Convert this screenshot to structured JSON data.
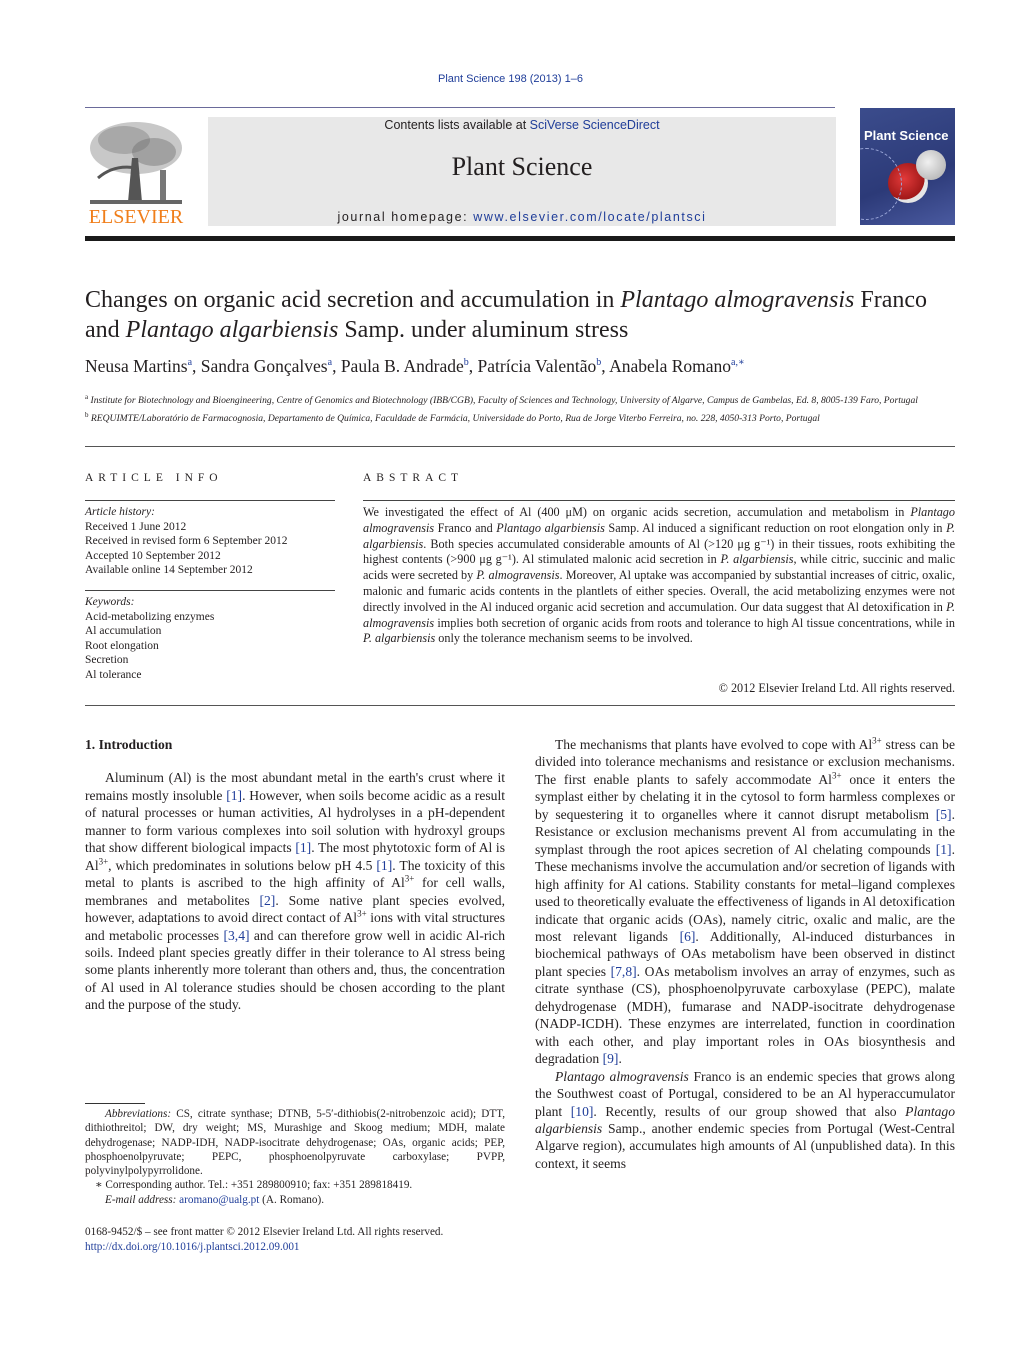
{
  "header": {
    "running_head": "Plant Science 198 (2013) 1–6",
    "contents_prefix": "Contents lists available at ",
    "contents_link": "SciVerse ScienceDirect",
    "journal_name": "Plant Science",
    "homepage_prefix": "journal homepage: ",
    "homepage_link": "www.elsevier.com/locate/plantsci",
    "publisher_logo": "ELSEVIER",
    "cover_title": "Plant Science"
  },
  "colors": {
    "link": "#1f3d99",
    "elsevier_orange": "#f07e1a",
    "masthead_bg": "#e8e8e8"
  },
  "article": {
    "title_part1": "Changes on organic acid secretion and accumulation in ",
    "title_italic1": "Plantago almogravensis",
    "title_part2": " Franco and ",
    "title_italic2": "Plantago algarbiensis",
    "title_part3": " Samp. under aluminum stress",
    "authors": [
      {
        "name": "Neusa Martins",
        "sup": "a"
      },
      {
        "name": "Sandra Gonçalves",
        "sup": "a"
      },
      {
        "name": "Paula B. Andrade",
        "sup": "b"
      },
      {
        "name": "Patrícia Valentão",
        "sup": "b"
      },
      {
        "name": "Anabela Romano",
        "sup": "a,∗"
      }
    ],
    "affiliations": [
      {
        "sup": "a",
        "text": "Institute for Biotechnology and Bioengineering, Centre of Genomics and Biotechnology (IBB/CGB), Faculty of Sciences and Technology, University of Algarve, Campus de Gambelas, Ed. 8, 8005-139 Faro, Portugal"
      },
      {
        "sup": "b",
        "text": "REQUIMTE/Laboratório de Farmacognosia, Departamento de Química, Faculdade de Farmácia, Universidade do Porto, Rua de Jorge Viterbo Ferreira, no. 228, 4050-313 Porto, Portugal"
      }
    ]
  },
  "article_info": {
    "heading": "ARTICLE INFO",
    "history_label": "Article history:",
    "history": [
      "Received 1 June 2012",
      "Received in revised form 6 September 2012",
      "Accepted 10 September 2012",
      "Available online 14 September 2012"
    ],
    "keywords_label": "Keywords:",
    "keywords": [
      "Acid-metabolizing enzymes",
      "Al accumulation",
      "Root elongation",
      "Secretion",
      "Al tolerance"
    ]
  },
  "abstract": {
    "heading": "ABSTRACT",
    "segments": [
      {
        "t": "We investigated the effect of Al (400 μM) on organic acids secretion, accumulation and metabolism in "
      },
      {
        "t": "Plantago almogravensis",
        "i": true
      },
      {
        "t": " Franco and "
      },
      {
        "t": "Plantago algarbiensis",
        "i": true
      },
      {
        "t": " Samp. Al induced a significant reduction on root elongation only in "
      },
      {
        "t": "P. algarbiensis",
        "i": true
      },
      {
        "t": ". Both species accumulated considerable amounts of Al (>120 μg g⁻¹) in their tissues, roots exhibiting the highest contents (>900 μg g⁻¹). Al stimulated malonic acid secretion in "
      },
      {
        "t": "P. algarbiensis",
        "i": true
      },
      {
        "t": ", while citric, succinic and malic acids were secreted by "
      },
      {
        "t": "P. almogravensis",
        "i": true
      },
      {
        "t": ". Moreover, Al uptake was accompanied by substantial increases of citric, oxalic, malonic and fumaric acids contents in the plantlets of either species. Overall, the acid metabolizing enzymes were not directly involved in the Al induced organic acid secretion and accumulation. Our data suggest that Al detoxification in "
      },
      {
        "t": "P. almogravensis",
        "i": true
      },
      {
        "t": " implies both secretion of organic acids from roots and tolerance to high Al tissue concentrations, while in "
      },
      {
        "t": "P. algarbiensis",
        "i": true
      },
      {
        "t": " only the tolerance mechanism seems to be involved."
      }
    ],
    "copyright": "© 2012 Elsevier Ireland Ltd. All rights reserved."
  },
  "body": {
    "section_title": "1.  Introduction",
    "left_paragraph": [
      {
        "t": "Aluminum (Al) is the most abundant metal in the earth's crust where it remains mostly insoluble "
      },
      {
        "t": "[1]",
        "c": true
      },
      {
        "t": ". However, when soils become acidic as a result of natural processes or human activities, Al hydrolyses in a pH-dependent manner to form various complexes into soil solution with hydroxyl groups that show different biological impacts "
      },
      {
        "t": "[1]",
        "c": true
      },
      {
        "t": ". The most phytotoxic form of Al is Al"
      },
      {
        "t": "3+",
        "s": true
      },
      {
        "t": ", which predominates in solutions below pH 4.5 "
      },
      {
        "t": "[1]",
        "c": true
      },
      {
        "t": ". The toxicity of this metal to plants is ascribed to the high affinity of Al"
      },
      {
        "t": "3+",
        "s": true
      },
      {
        "t": " for cell walls, membranes and metabolites "
      },
      {
        "t": "[2]",
        "c": true
      },
      {
        "t": ". Some native plant species evolved, however, adaptations to avoid direct contact of Al"
      },
      {
        "t": "3+",
        "s": true
      },
      {
        "t": " ions with vital structures and metabolic processes "
      },
      {
        "t": "[3,4]",
        "c": true
      },
      {
        "t": " and can therefore grow well in acidic Al-rich soils. Indeed plant species greatly differ in their tolerance to Al stress being some plants inherently more tolerant than others and, thus, the concentration of Al used in Al tolerance studies should be chosen according to the plant and the purpose of the study."
      }
    ],
    "right_paragraph1": [
      {
        "t": "The mechanisms that plants have evolved to cope with Al"
      },
      {
        "t": "3+",
        "s": true
      },
      {
        "t": " stress can be divided into tolerance mechanisms and resistance or exclusion mechanisms. The first enable plants to safely accommodate Al"
      },
      {
        "t": "3+",
        "s": true
      },
      {
        "t": " once it enters the symplast either by chelating it in the cytosol to form harmless complexes or by sequestering it to organelles where it cannot disrupt metabolism "
      },
      {
        "t": "[5]",
        "c": true
      },
      {
        "t": ". Resistance or exclusion mechanisms prevent Al from accumulating in the symplast through the root apices secretion of Al chelating compounds "
      },
      {
        "t": "[1]",
        "c": true
      },
      {
        "t": ". These mechanisms involve the accumulation and/or secretion of ligands with high affinity for Al cations. Stability constants for metal–ligand complexes used to theoretically evaluate the effectiveness of ligands in Al detoxification indicate that organic acids (OAs), namely citric, oxalic and malic, are the most relevant ligands "
      },
      {
        "t": "[6]",
        "c": true
      },
      {
        "t": ". Additionally, Al-induced disturbances in biochemical pathways of OAs metabolism have been observed in distinct plant species "
      },
      {
        "t": "[7,8]",
        "c": true
      },
      {
        "t": ". OAs metabolism involves an array of enzymes, such as citrate synthase (CS), phosphoenolpyruvate carboxylase (PEPC), malate dehydrogenase (MDH), fumarase and NADP-isocitrate dehydrogenase (NADP-ICDH). These enzymes are interrelated, function in coordination with each other, and play important roles in OAs biosynthesis and degradation "
      },
      {
        "t": "[9]",
        "c": true
      },
      {
        "t": "."
      }
    ],
    "right_paragraph2": [
      {
        "t": "Plantago almogravensis",
        "i": true
      },
      {
        "t": " Franco is an endemic species that grows along the Southwest coast of Portugal, considered to be an Al hyperaccumulator plant "
      },
      {
        "t": "[10]",
        "c": true
      },
      {
        "t": ". Recently, results of our group showed that also "
      },
      {
        "t": "Plantago algarbiensis",
        "i": true
      },
      {
        "t": " Samp., another endemic species from Portugal (West-Central Algarve region), accumulates high amounts of Al (unpublished data). In this context, it seems"
      }
    ]
  },
  "footnotes": {
    "abbreviations_label": "Abbreviations:",
    "abbreviations_text": " CS, citrate synthase; DTNB, 5-5′-dithiobis(2-nitrobenzoic acid); DTT, dithiothreitol; DW, dry weight; MS, Murashige and Skoog medium; MDH, malate dehydrogenase; NADP-IDH, NADP-isocitrate dehydrogenase; OAs, organic acids; PEP, phosphoenolpyruvate; PEPC, phosphoenolpyruvate carboxylase; PVPP, polyvinylpolypyrrolidone.",
    "corresponding": "∗ Corresponding author. Tel.: +351 289800910; fax: +351 289818419.",
    "email_label": "E-mail address:",
    "email": "aromano@ualg.pt",
    "email_suffix": " (A. Romano).",
    "front_matter": "0168-9452/$ – see front matter © 2012 Elsevier Ireland Ltd. All rights reserved.",
    "doi": "http://dx.doi.org/10.1016/j.plantsci.2012.09.001"
  }
}
